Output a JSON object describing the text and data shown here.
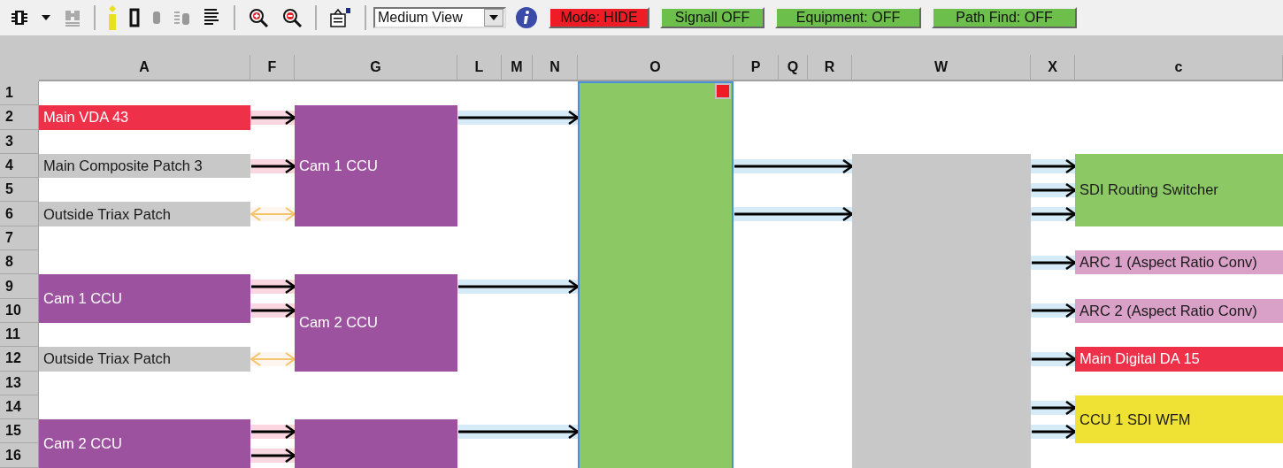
{
  "toolbar": {
    "view_select": {
      "value": "Medium View"
    },
    "buttons": [
      {
        "label": "Mode: HIDE",
        "color": "#ee1c25"
      },
      {
        "label": "Signall OFF",
        "color": "#6cbf4a"
      },
      {
        "label": "Equipment: OFF",
        "color": "#6cbf4a"
      },
      {
        "label": "Path Find: OFF",
        "color": "#6cbf4a"
      }
    ]
  },
  "grid": {
    "columns": [
      "A",
      "F",
      "G",
      "L",
      "M",
      "N",
      "O",
      "P",
      "Q",
      "R",
      "W",
      "X",
      "c"
    ],
    "rows": [
      "1",
      "2",
      "3",
      "4",
      "5",
      "6",
      "7",
      "8",
      "9",
      "10",
      "11",
      "12",
      "13",
      "14",
      "15",
      "16"
    ]
  },
  "blocks": [
    {
      "color": "#8cc864",
      "selected": true
    },
    {
      "label": "Main VDA 43",
      "color": "#ee3048",
      "selected": false
    },
    {
      "label": "Main Composite Patch 3",
      "color": "#c8c8c8",
      "selected": false
    },
    {
      "label": "Cam 1 CCU",
      "color": "#9d52a0",
      "selected": false
    },
    {
      "color": "#c8c8c8",
      "selected": false
    },
    {
      "label": "SDI Routing Switcher",
      "color": "#8cc864",
      "selected": false
    },
    {
      "label": "Outside Triax Patch",
      "color": "#c8c8c8",
      "selected": false
    },
    {
      "label": "ARC 1 (Aspect Ratio Conv)",
      "color": "#d9a0c8",
      "selected": false
    },
    {
      "label": "Cam 1 CCU",
      "color": "#9d52a0",
      "selected": false
    },
    {
      "label": "ARC 2 (Aspect Ratio Conv)",
      "color": "#d9a0c8",
      "selected": false
    },
    {
      "label": "Cam 2 CCU",
      "color": "#9d52a0",
      "selected": false
    },
    {
      "label": "Outside Triax Patch",
      "color": "#c8c8c8",
      "selected": false
    },
    {
      "label": "Main Digital DA 15",
      "color": "#ee3048",
      "selected": false
    },
    {
      "label": "CCU 1 SDI WFM",
      "color": "#f0e234",
      "selected": false
    },
    {
      "label": "Cam 2 CCU",
      "color": "#9d52a0",
      "selected": false
    },
    {
      "color": "#9d52a0",
      "selected": false
    }
  ],
  "connectors": [
    {
      "kind": "arrow",
      "color": "#f9d6e0"
    },
    {
      "kind": "arrow",
      "color": "#d5ecf8"
    },
    {
      "kind": "arrow",
      "color": "#f9d6e0"
    },
    {
      "kind": "arrow",
      "color": "#d5ecf8"
    },
    {
      "kind": "arrow",
      "color": "#d5ecf8"
    },
    {
      "kind": "arrow",
      "color": "#d5ecf8"
    },
    {
      "kind": "double-arrow",
      "color": "#fdf5ef"
    },
    {
      "kind": "arrow",
      "color": "#d5ecf8"
    },
    {
      "kind": "arrow",
      "color": "#d5ecf8"
    },
    {
      "kind": "arrow",
      "color": "#d5ecf8"
    },
    {
      "kind": "arrow",
      "color": "#f9d6e0"
    },
    {
      "kind": "arrow",
      "color": "#d5ecf8"
    },
    {
      "kind": "arrow",
      "color": "#f9d6e0"
    },
    {
      "kind": "arrow",
      "color": "#d5ecf8"
    },
    {
      "kind": "double-arrow",
      "color": "#fdf5ef"
    },
    {
      "kind": "arrow",
      "color": "#d5ecf8"
    },
    {
      "kind": "arrow",
      "color": "#d5ecf8"
    },
    {
      "kind": "arrow",
      "color": "#f9d6e0"
    },
    {
      "kind": "arrow",
      "color": "#d5ecf8"
    },
    {
      "kind": "arrow",
      "color": "#d5ecf8"
    },
    {
      "kind": "arrow",
      "color": "#f9d6e0"
    }
  ]
}
